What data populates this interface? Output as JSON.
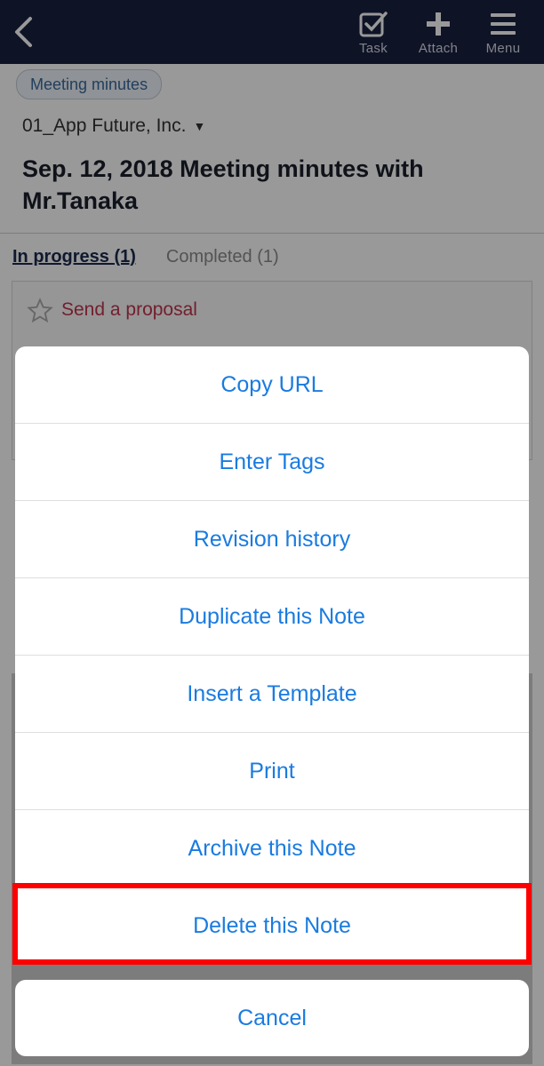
{
  "navbar": {
    "task_label": "Task",
    "attach_label": "Attach",
    "menu_label": "Menu"
  },
  "note": {
    "tag": "Meeting minutes",
    "company": "01_App Future, Inc.",
    "title": "Sep. 12, 2018 Meeting minutes with Mr.Tanaka",
    "tabs": [
      {
        "label": "In progress (1)",
        "active": true
      },
      {
        "label": "Completed (1)",
        "active": false
      }
    ],
    "task": {
      "title": "Send a proposal"
    }
  },
  "action_sheet": {
    "items": [
      {
        "label": "Copy URL"
      },
      {
        "label": "Enter Tags"
      },
      {
        "label": "Revision history"
      },
      {
        "label": "Duplicate this Note"
      },
      {
        "label": "Insert a Template"
      },
      {
        "label": "Print"
      },
      {
        "label": "Archive this Note"
      },
      {
        "label": "Delete this Note",
        "highlighted": true
      }
    ],
    "cancel_label": "Cancel"
  },
  "colors": {
    "navbar": "#1a2040",
    "action_text": "#1a7be0",
    "highlight_border": "#ff0000",
    "task_title": "#c2334d"
  }
}
